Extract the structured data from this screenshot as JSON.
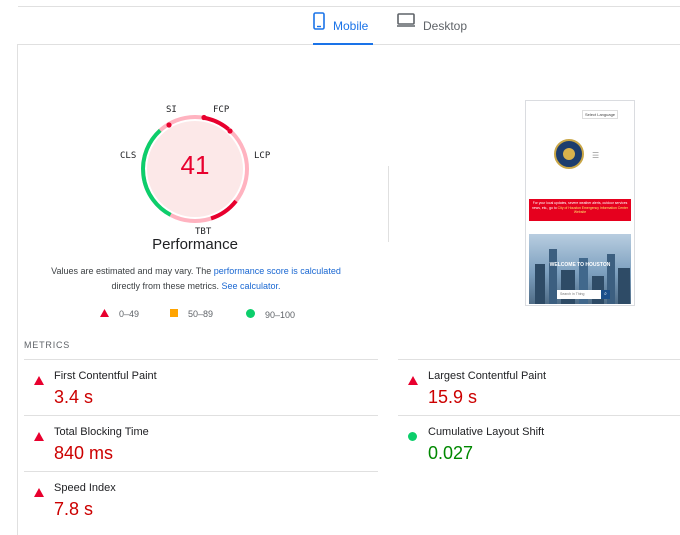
{
  "tabs": [
    {
      "label": "Mobile",
      "icon": "smartphone-icon",
      "active": true
    },
    {
      "label": "Desktop",
      "icon": "desktop-icon",
      "active": false
    }
  ],
  "gauge": {
    "score": "41",
    "score_value": 0.41,
    "title": "Performance",
    "labels": {
      "si": "SI",
      "fcp": "FCP",
      "lcp": "LCP",
      "tbt": "TBT",
      "cls": "CLS"
    }
  },
  "note": {
    "text1": "Values are estimated and may vary. The ",
    "link1": "performance score is calculated",
    "text2": "directly from these metrics. ",
    "link2": "See calculator."
  },
  "legend": [
    {
      "range": "0–49",
      "shape": "triangle",
      "color": "#e8002e"
    },
    {
      "range": "50–89",
      "shape": "square",
      "color": "#ffa400"
    },
    {
      "range": "90–100",
      "shape": "circle",
      "color": "#0cce6b"
    }
  ],
  "thumbnail": {
    "lang_select": "Select Language",
    "alert_text": "For your local updates, severe weather alerts, outdoor services news, etc., go to",
    "alert_link": "City of Houston Emergency Information Center Website",
    "hero_text": "WELCOME TO HOUSTON",
    "search_placeholder": "Search in Thing"
  },
  "metrics": {
    "title": "METRICS",
    "items": [
      {
        "name": "First Contentful Paint",
        "value": "3.4 s",
        "status": "red"
      },
      {
        "name": "Largest Contentful Paint",
        "value": "15.9 s",
        "status": "red"
      },
      {
        "name": "Total Blocking Time",
        "value": "840 ms",
        "status": "red"
      },
      {
        "name": "Cumulative Layout Shift",
        "value": "0.027",
        "status": "green"
      },
      {
        "name": "Speed Index",
        "value": "7.8 s",
        "status": "red"
      }
    ]
  },
  "colors": {
    "fail": "#e8002e",
    "average": "#ffa400",
    "pass": "#0cce6b",
    "accent": "#1a73e8"
  }
}
